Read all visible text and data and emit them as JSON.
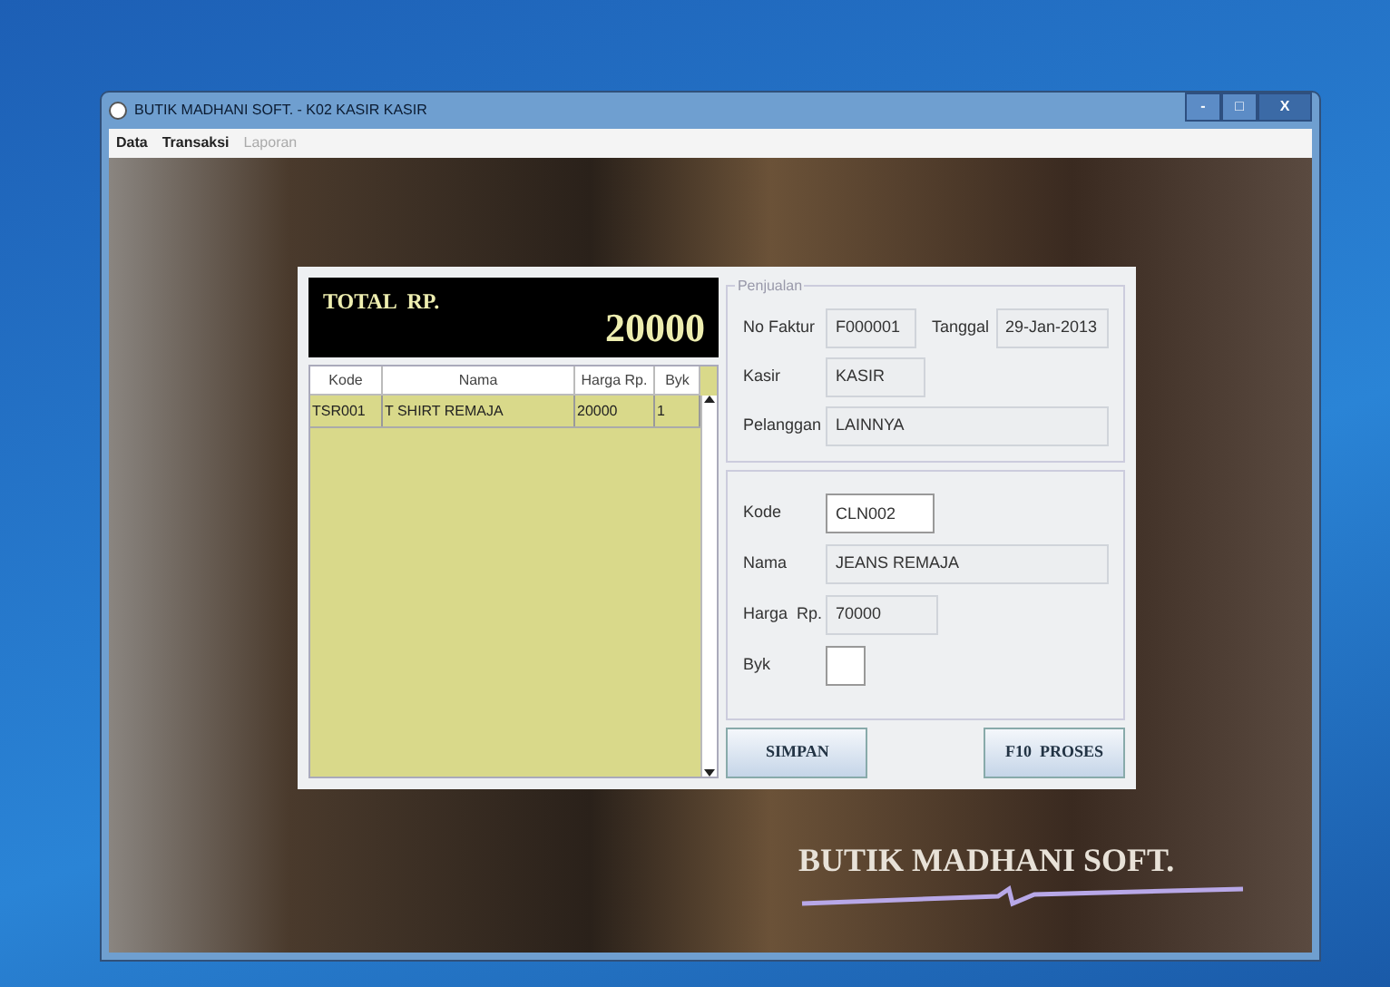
{
  "window": {
    "title": "BUTIK MADHANI SOFT. - K02 KASIR KASIR",
    "controls": [
      "-",
      "□",
      "X"
    ]
  },
  "menu": [
    {
      "label": "Data",
      "disabled": false
    },
    {
      "label": "Transaksi",
      "disabled": false
    },
    {
      "label": "Laporan",
      "disabled": true
    }
  ],
  "total": {
    "label": "TOTAL  RP.",
    "value": "20000"
  },
  "table": {
    "columns": [
      "Kode",
      "Nama",
      "Harga Rp.",
      "Byk"
    ],
    "rows": [
      [
        "TSR001",
        "T SHIRT REMAJA",
        "20000",
        "1"
      ]
    ]
  },
  "penjualan": {
    "title": "Penjualan",
    "no_faktur": {
      "label": "No Faktur",
      "value": "F000001"
    },
    "tanggal": {
      "label": "Tanggal",
      "value": "29-Jan-2013"
    },
    "kasir": {
      "label": "Kasir",
      "value": "KASIR"
    },
    "pelanggan": {
      "label": "Pelanggan",
      "value": "LAINNYA"
    }
  },
  "item": {
    "kode": {
      "label": "Kode",
      "value": "CLN002"
    },
    "nama": {
      "label": "Nama",
      "value": "JEANS REMAJA"
    },
    "harga": {
      "label": "Harga  Rp.",
      "value": "70000"
    },
    "byk": {
      "label": "Byk"
    }
  },
  "buttons": [
    "SIMPAN",
    "F10  PROSES"
  ],
  "brand": "BUTIK MADHANI SOFT."
}
